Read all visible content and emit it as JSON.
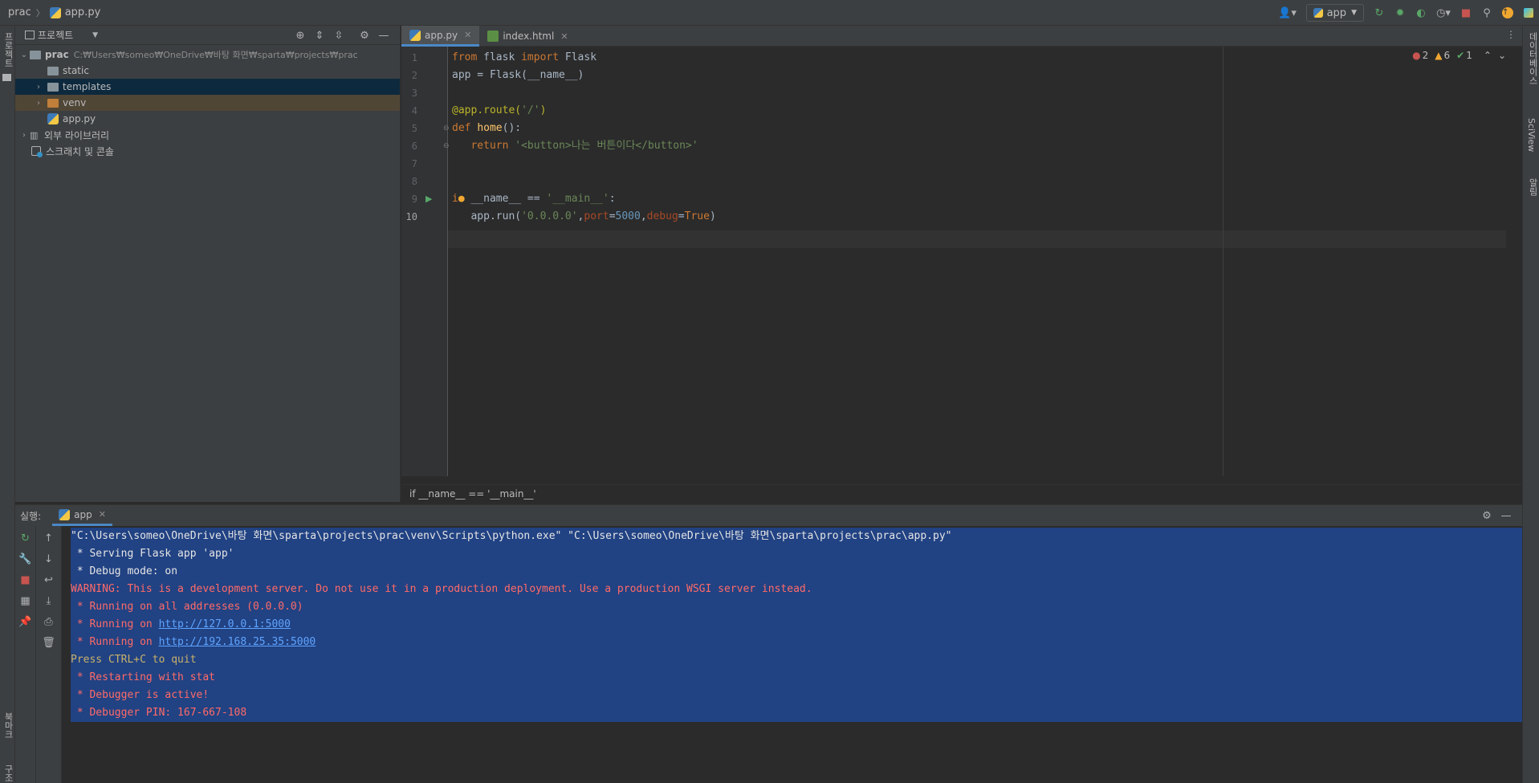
{
  "navbar": {
    "project": "prac",
    "file": "app.py",
    "run_config": "app",
    "icons": [
      "user-icon",
      "run-icon",
      "debug-icon",
      "coverage-icon",
      "profile-icon",
      "stop-icon",
      "search-icon",
      "update-icon",
      "toolbox-icon"
    ]
  },
  "left_strip": {
    "project_label": "프로젝트",
    "bookmarks_label": "북마크",
    "structure_label": "구조"
  },
  "right_strip": {
    "database_label": "데이터베이스",
    "sciview_label": "SciView",
    "notifications_label": "알림"
  },
  "project_panel": {
    "title": "프로젝트",
    "tree": [
      {
        "label": "prac",
        "hint": "C:₩Users₩someo₩OneDrive₩바탕 화면₩sparta₩projects₩prac",
        "level": 0,
        "expanded": true
      },
      {
        "label": "static",
        "level": 1
      },
      {
        "label": "templates",
        "level": 1,
        "selected": true
      },
      {
        "label": "venv",
        "level": 1,
        "ignored": true
      },
      {
        "label": "app.py",
        "level": 1
      },
      {
        "label": "외부 라이브러리",
        "level": 0
      },
      {
        "label": "스크래치 및 콘솔",
        "level": 0
      }
    ]
  },
  "editor": {
    "tabs": [
      {
        "label": "app.py",
        "active": true
      },
      {
        "label": "index.html",
        "active": false
      }
    ],
    "inspection": {
      "errors": "2",
      "warnings": "6",
      "ok": "1"
    },
    "line_numbers": [
      "1",
      "2",
      "3",
      "4",
      "5",
      "6",
      "7",
      "8",
      "9",
      "10"
    ],
    "breadcrumb": "if __name__ == '__main__'"
  },
  "run_panel": {
    "label": "실행:",
    "tab": "app",
    "console": [
      "\"C:\\Users\\someo\\OneDrive\\바탕 화면\\sparta\\projects\\prac\\venv\\Scripts\\python.exe\" \"C:\\Users\\someo\\OneDrive\\바탕 화면\\sparta\\projects\\prac\\app.py\"",
      " * Serving Flask app 'app'",
      " * Debug mode: on",
      "WARNING: This is a development server. Do not use it in a production deployment. Use a production WSGI server instead.",
      " * Running on all addresses (0.0.0.0)",
      " * Running on ",
      "http://127.0.0.1:5000",
      " * Running on ",
      "http://192.168.25.35:5000",
      "Press CTRL+C to quit",
      " * Restarting with stat",
      " * Debugger is active!",
      " * Debugger PIN: 167-667-108"
    ]
  },
  "colors": {
    "bg_editor": "#2b2b2b",
    "bg_panel": "#3c3f41",
    "selection": "#214283",
    "accent": "#4a88c7",
    "error": "#ff6b68"
  }
}
